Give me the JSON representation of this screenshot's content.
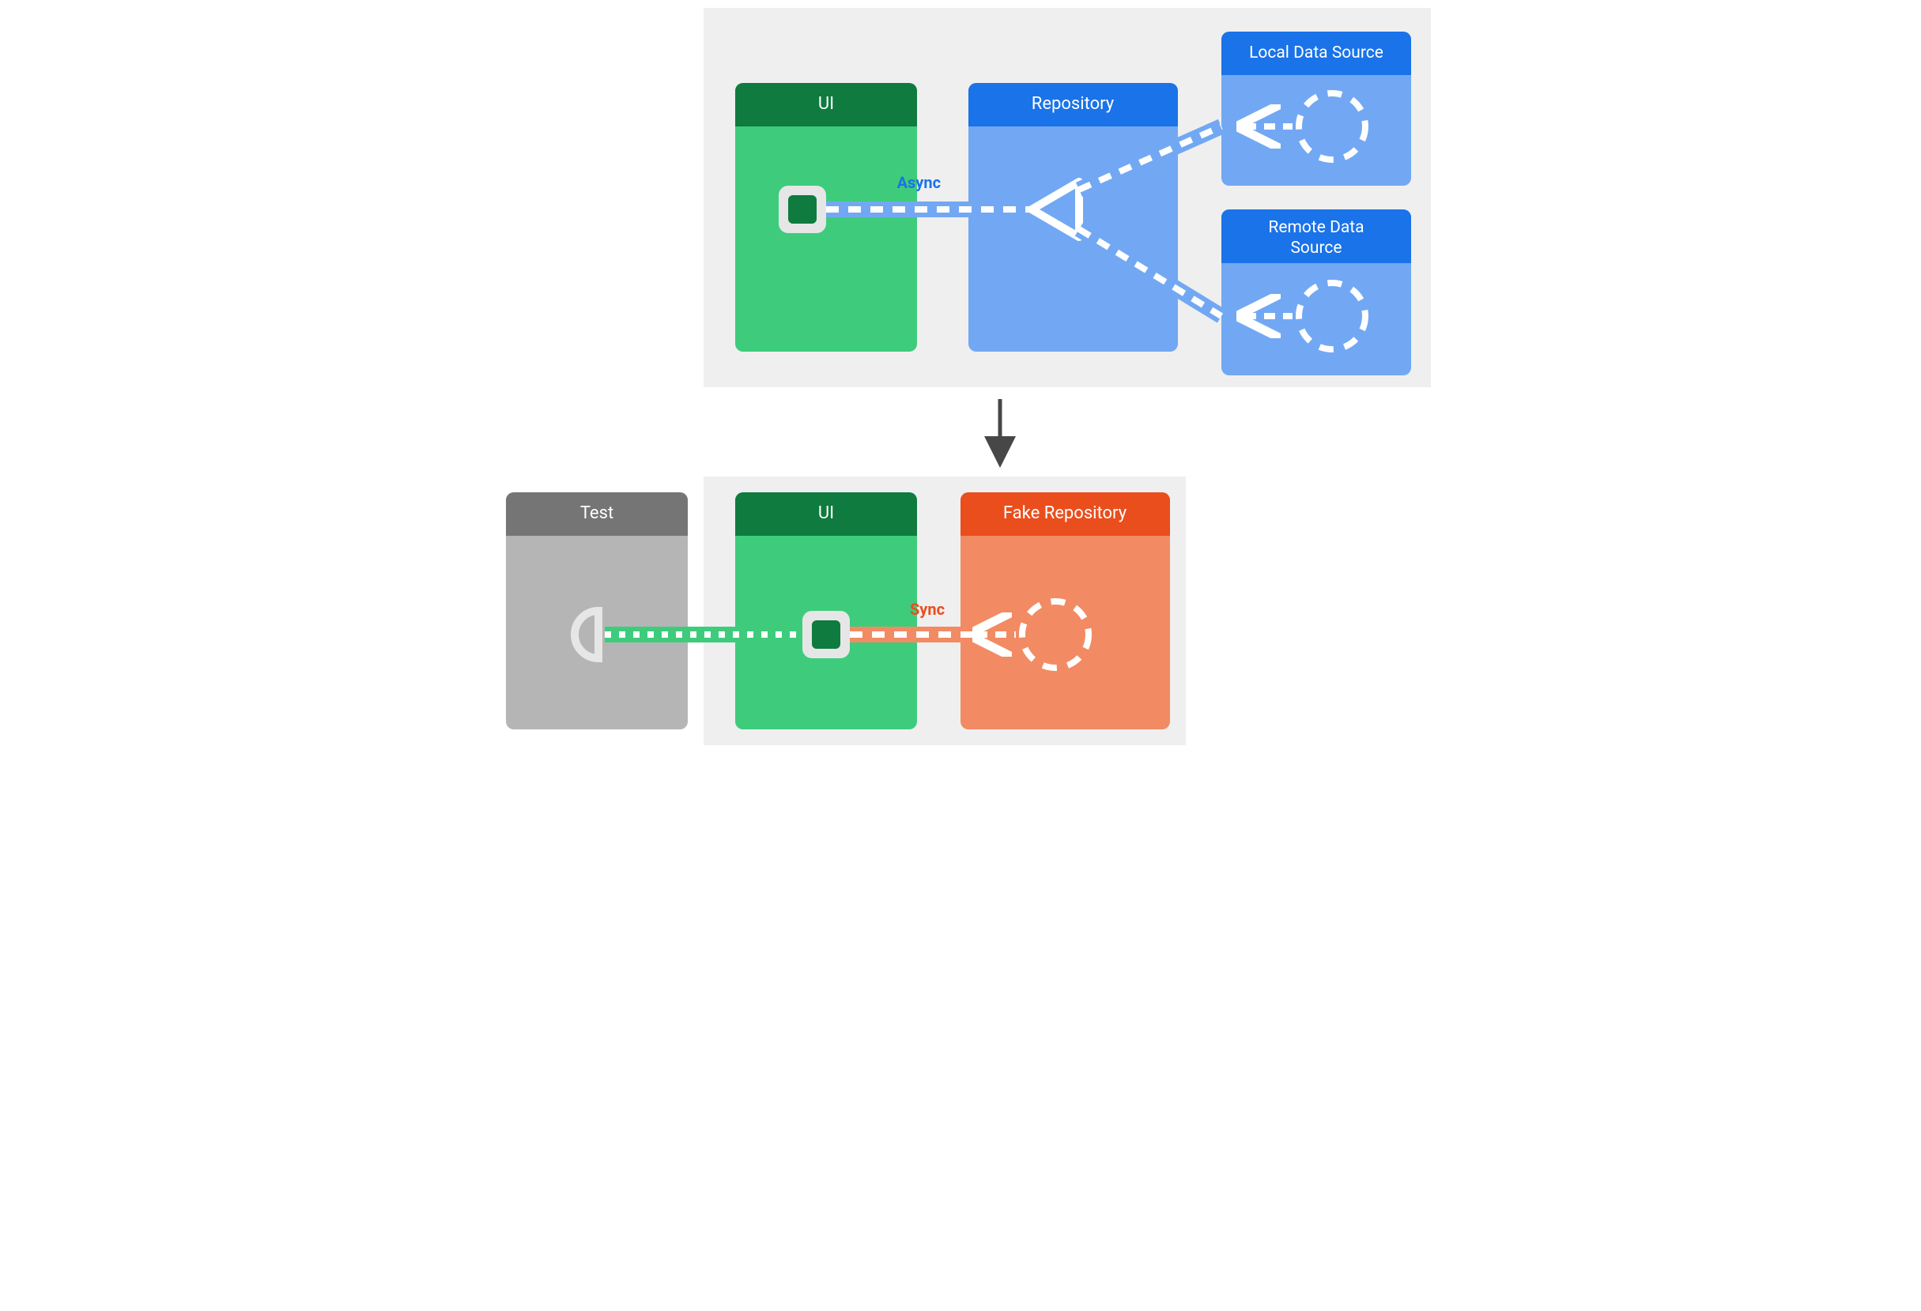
{
  "diagram": {
    "top_group": {
      "ui_box_title": "UI",
      "repo_box_title": "Repository",
      "local_box_title": "Local Data Source",
      "remote_box_title_line1": "Remote Data",
      "remote_box_title_line2": "Source",
      "edge_label": "Async"
    },
    "bottom_group": {
      "test_box_title": "Test",
      "ui_box_title": "UI",
      "fake_repo_box_title": "Fake Repository",
      "edge_label": "Sync"
    }
  },
  "colors": {
    "bg_panel": "#efeff0",
    "green_dark": "#0f7b3e",
    "green_light": "#3ecc7c",
    "blue_dark": "#1a73e8",
    "blue_light": "#72a8f3",
    "orange_dark": "#ea4e1d",
    "orange_light": "#f28b63",
    "gray_dark": "#757575",
    "gray_light": "#b5b5b5",
    "white": "#ffffff",
    "label_blue": "#1a73e8",
    "label_orange": "#ea4e1d",
    "arrow_gray": "#474747"
  }
}
